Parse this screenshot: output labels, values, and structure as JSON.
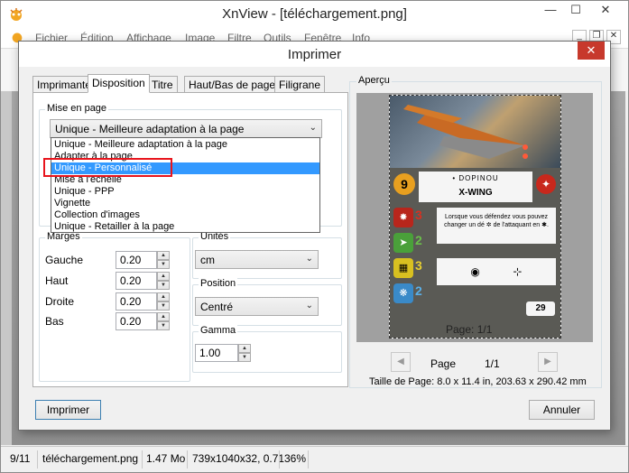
{
  "main_window": {
    "title": "XnView - [téléchargement.png]",
    "menus": [
      "Fichier",
      "Édition",
      "Affichage",
      "Image",
      "Filtre",
      "Outils",
      "Fenêtre",
      "Info"
    ],
    "status": {
      "position": "9/11",
      "filename": "téléchargement.png",
      "filesize": "1.47 Mo",
      "dimensions": "739x1040x32, 0.71",
      "zoom": "36%"
    }
  },
  "dialog": {
    "title": "Imprimer",
    "tabs": [
      "Imprimante",
      "Disposition",
      "Titre",
      "Haut/Bas de page",
      "Filigrane"
    ],
    "active_tab": "Disposition",
    "layout_group": {
      "label": "Mise en page",
      "selected": "Unique - Meilleure adaptation à la page",
      "options": [
        "Unique - Meilleure adaptation à la page",
        "Adapter à la page",
        "Unique - Personnalisé",
        "Mise à l'échelle",
        "Unique - PPP",
        "Vignette",
        "Collection d'images",
        "Unique - Retailler à la page"
      ],
      "highlighted": "Unique - Personnalisé"
    },
    "margins": {
      "label": "Marges",
      "rows": [
        {
          "label": "Gauche",
          "value": "0.20"
        },
        {
          "label": "Haut",
          "value": "0.20"
        },
        {
          "label": "Droite",
          "value": "0.20"
        },
        {
          "label": "Bas",
          "value": "0.20"
        }
      ]
    },
    "units": {
      "label": "Unités",
      "value": "cm"
    },
    "position": {
      "label": "Position",
      "value": "Centré"
    },
    "gamma": {
      "label": "Gamma",
      "value": "1.00"
    },
    "preview": {
      "label": "Aperçu",
      "page_label": "Page",
      "page_count": "1/1",
      "overlay_text": "Page: 1/1",
      "page_size": "Taille de Page: 8.0 x 11.4 in, 203.63 x 290.42 mm",
      "card": {
        "pilot_skill": "9",
        "pilot_name": "• DOPINOU",
        "ship_name": "X-WING",
        "stats": [
          "3",
          "2",
          "3",
          "2"
        ],
        "ability_text": "Lorsque vous défendez vous pouvez changer un dé ✲ de l'attaquant en ✱.",
        "cost": "29"
      }
    },
    "buttons": {
      "print": "Imprimer",
      "cancel": "Annuler"
    }
  }
}
